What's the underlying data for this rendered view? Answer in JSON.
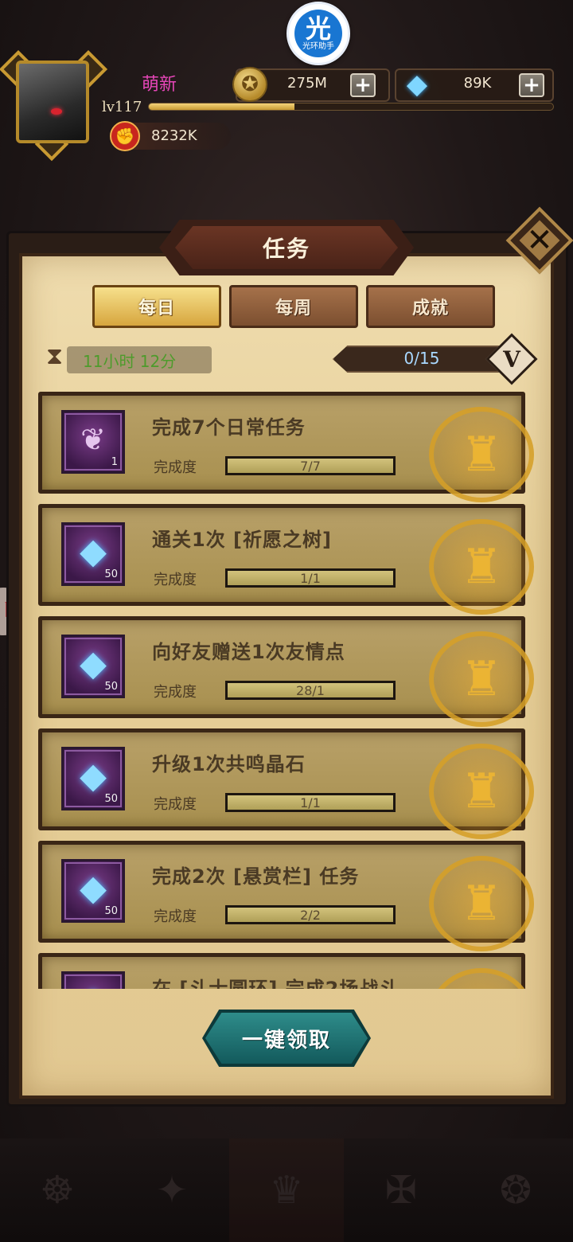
{
  "overlay": {
    "badge_glyph": "光",
    "badge_label": "光环助手"
  },
  "player": {
    "name": "萌新",
    "level": "lv117",
    "level_progress_fraction": 0.36,
    "power": "8232K"
  },
  "resources": {
    "gold": "275M",
    "diamonds": "89K"
  },
  "dialog": {
    "title": "任务",
    "tabs": [
      {
        "label": "每日",
        "active": true
      },
      {
        "label": "每周",
        "active": false
      },
      {
        "label": "成就",
        "active": false
      }
    ],
    "timer": "11小时 12分",
    "progress": "0/15",
    "vip_badge": "V",
    "progress_label": "完成度",
    "tasks": [
      {
        "title": "完成7个日常任务",
        "reward_icon": "scroll-icon",
        "reward_qty": "1",
        "progress": "7/7",
        "fill": 1.0
      },
      {
        "title": "通关1次 [祈愿之树]",
        "reward_icon": "diamond-icon",
        "reward_qty": "50",
        "progress": "1/1",
        "fill": 1.0
      },
      {
        "title": "向好友赠送1次友情点",
        "reward_icon": "diamond-icon",
        "reward_qty": "50",
        "progress": "28/1",
        "fill": 1.0
      },
      {
        "title": "升级1次共鸣晶石",
        "reward_icon": "diamond-icon",
        "reward_qty": "50",
        "progress": "1/1",
        "fill": 1.0
      },
      {
        "title": "完成2次 [悬赏栏] 任务",
        "reward_icon": "diamond-icon",
        "reward_qty": "50",
        "progress": "2/2",
        "fill": 1.0
      },
      {
        "title": "在 [斗士圆环] 完成2场战斗",
        "reward_icon": "diamond-icon",
        "reward_qty": "",
        "progress": "",
        "fill": 0
      }
    ],
    "claim_all": "一键领取"
  },
  "colors": {
    "name_magenta": "#e646b8",
    "timer_green": "#4e9b2c",
    "progress_blue": "#a9d8ff",
    "claim_teal": "#2e8c8a"
  }
}
